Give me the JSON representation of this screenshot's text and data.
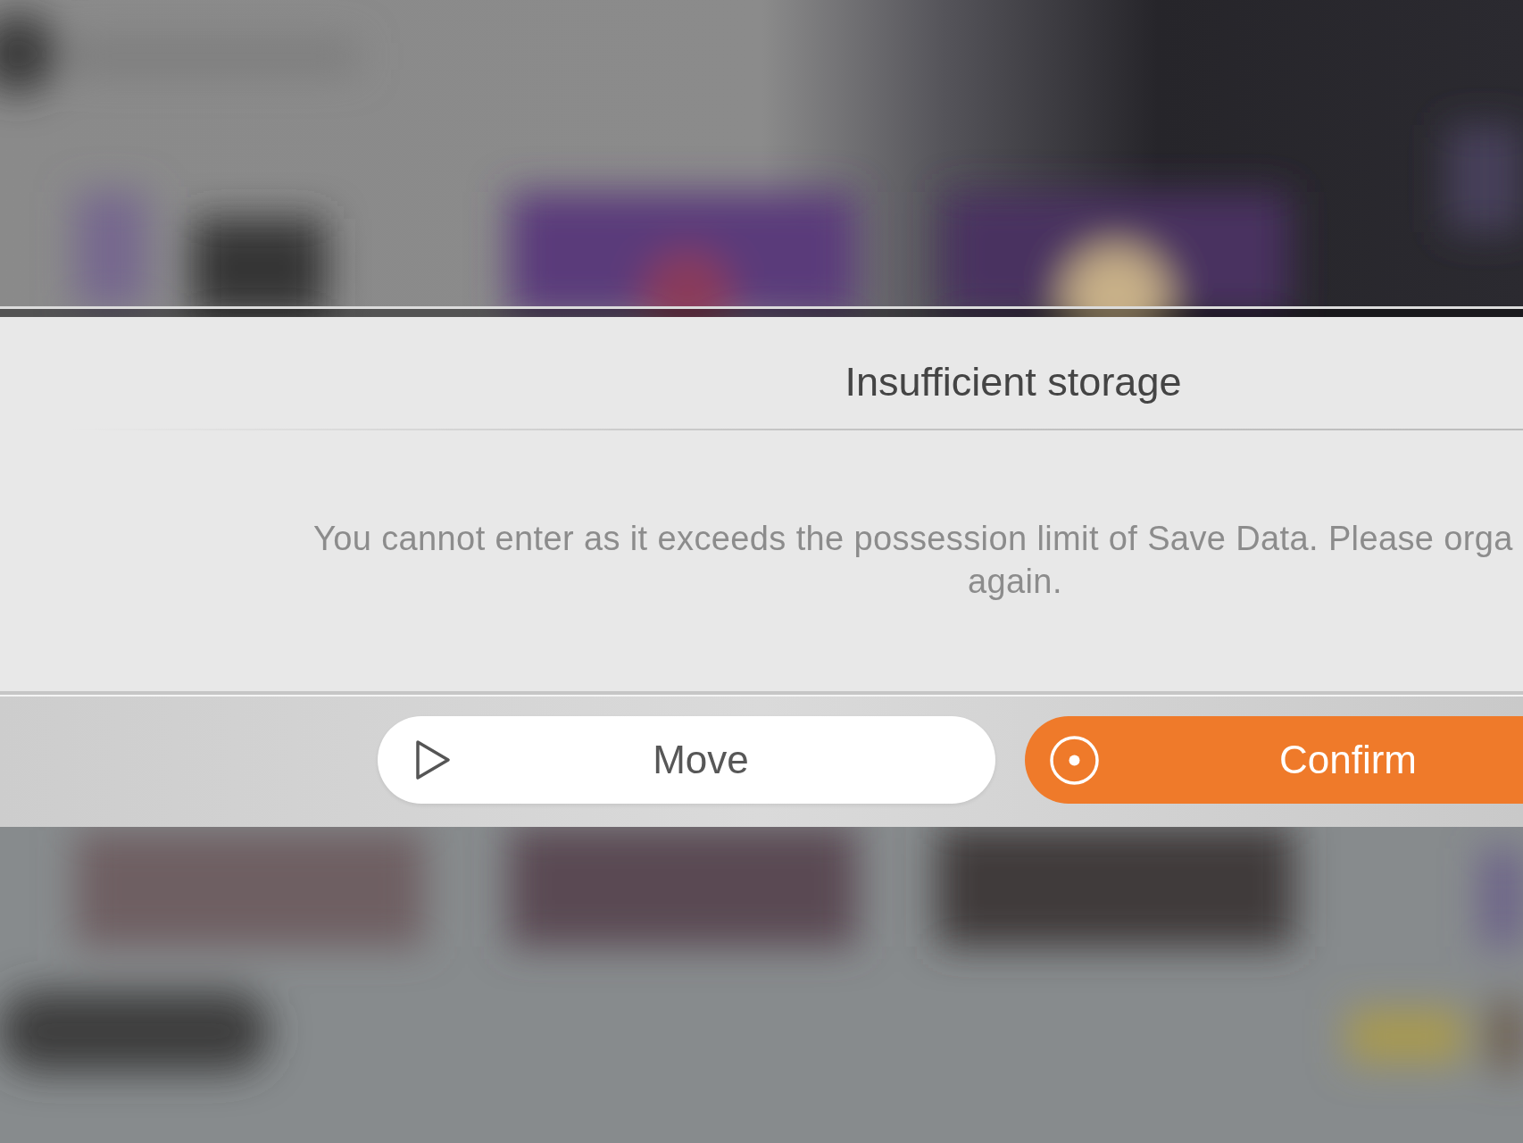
{
  "dialog": {
    "title": "Insufficient storage",
    "message_lines": [
      "You cannot enter as it exceeds the possession limit of Save Data. Please orga",
      "again."
    ]
  },
  "buttons": [
    {
      "label": "Move",
      "kind": "secondary"
    },
    {
      "label": "Confirm",
      "kind": "primary"
    }
  ]
}
